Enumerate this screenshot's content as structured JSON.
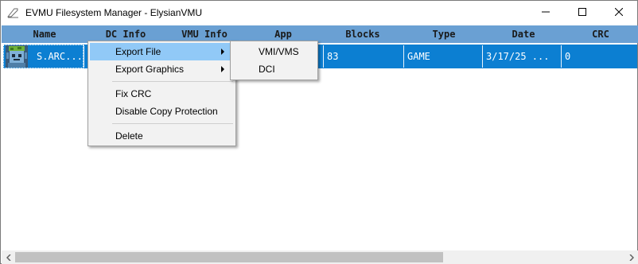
{
  "window": {
    "title": "EVMU Filesystem Manager - ElysianVMU"
  },
  "table": {
    "columns": [
      "Name",
      "DC Info",
      "VMU Info",
      "App",
      "Blocks",
      "Type",
      "Date",
      "CRC"
    ],
    "rows": [
      {
        "name": "S.ARC...",
        "blocks": "83",
        "type": "GAME",
        "date": "3/17/25 ...",
        "crc": "0"
      }
    ],
    "header_color": "#6aa0d3",
    "selected_row_color": "#0c7fd2"
  },
  "context_menu": {
    "items": {
      "export_file": "Export File",
      "export_graphics": "Export Graphics",
      "fix_crc": "Fix CRC",
      "disable_copy_protection": "Disable Copy Protection",
      "delete": "Delete"
    },
    "highlight_color": "#91c9f7"
  },
  "export_submenu": {
    "items": [
      "VMI/VMS",
      "DCI"
    ]
  }
}
